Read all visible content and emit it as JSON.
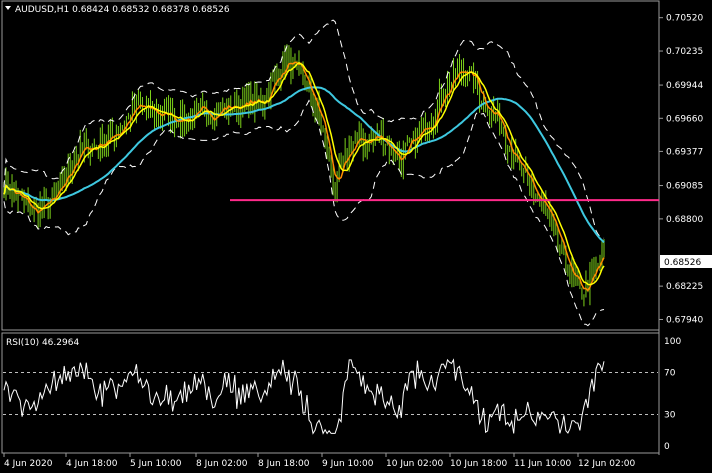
{
  "header": {
    "symbol_line": "AUDUSD,H1  0.68424 0.68532 0.68378 0.68526"
  },
  "rsi_header": "RSI(10) 46.2964",
  "price_axis": [
    "0.70520",
    "0.70235",
    "0.69944",
    "0.69660",
    "0.69377",
    "0.69085",
    "0.68800",
    "0.68526",
    "0.68225",
    "0.67940"
  ],
  "current_price": "0.68526",
  "rsi_axis": [
    "100",
    "70",
    "30",
    "0"
  ],
  "time_axis": [
    "4 Jun 2020",
    "4 Jun 18:00",
    "5 Jun 10:00",
    "8 Jun 02:00",
    "8 Jun 18:00",
    "9 Jun 10:00",
    "10 Jun 02:00",
    "10 Jun 18:00",
    "11 Jun 10:00",
    "12 Jun 02:00"
  ],
  "colors": {
    "candles": "#7cd11a",
    "ma_fast": "#ff8c00",
    "ma_mid": "#ffff00",
    "ma_slow": "#3ec8e0",
    "bands": "#ffffff",
    "level": "#ff2a8a",
    "grid": "#ffffff",
    "rsi": "#ffffff"
  },
  "price_range": [
    0.6785,
    0.7062
  ],
  "level_price": 0.6896,
  "rsi_levels": [
    70,
    30
  ],
  "chart_data": {
    "type": "line",
    "x": [
      "4 Jun 2020",
      "4 Jun 18:00",
      "5 Jun 10:00",
      "8 Jun 02:00",
      "8 Jun 18:00",
      "9 Jun 10:00",
      "10 Jun 02:00",
      "10 Jun 18:00",
      "11 Jun 10:00",
      "12 Jun 02:00"
    ],
    "series": [
      {
        "values": [
          0.689,
          0.692,
          0.6975,
          0.6975,
          0.7005,
          0.6945,
          0.696,
          0.7,
          0.6905,
          0.685
        ]
      }
    ],
    "ylim": [
      0.6785,
      0.7062
    ]
  }
}
